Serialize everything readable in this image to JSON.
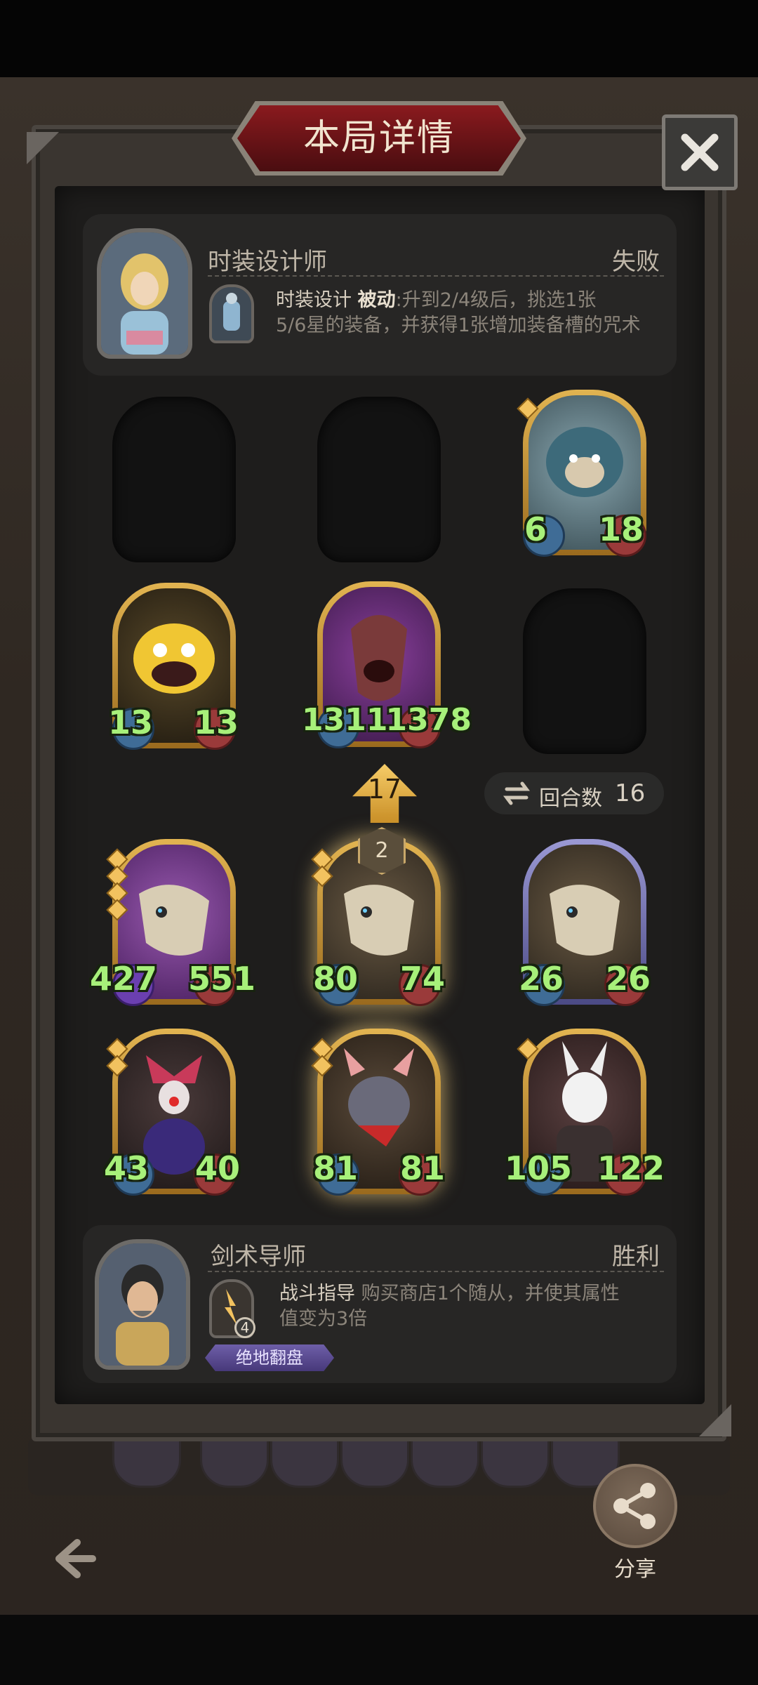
{
  "header": {
    "title": "本局详情"
  },
  "close_icon": "close-icon",
  "player1": {
    "hero_name": "时装设计师",
    "result": "失败",
    "skill_name": "时装设计",
    "skill_type": "被动",
    "skill_desc_line1": ":升到2/4级后，挑选1张",
    "skill_desc_line2": "5/6星的装备，并获得1张增加装备槽的咒术"
  },
  "board": {
    "row1": [
      {
        "slot": "empty"
      },
      {
        "slot": "empty"
      },
      {
        "atk": "6",
        "hp": "18",
        "stars": 1,
        "frame": "gold",
        "art": "blue-beast"
      }
    ],
    "row2": [
      {
        "atk": "13",
        "hp": "13",
        "stars": 0,
        "frame": "gold",
        "art": "yellow-gremlin"
      },
      {
        "atk": "1311",
        "hp": "1378",
        "stars": 0,
        "frame": "gold",
        "art": "purple-dragon"
      },
      {
        "slot": "empty"
      }
    ],
    "row3": [
      {
        "atk": "427",
        "hp": "551",
        "stars": 4,
        "frame": "gold",
        "art": "bone-dragon-purple"
      },
      {
        "atk": "80",
        "hp": "74",
        "stars": 2,
        "frame": "gold",
        "art": "bone-dragon"
      },
      {
        "atk": "26",
        "hp": "26",
        "stars": 0,
        "frame": "silver",
        "art": "bone-dragon"
      }
    ],
    "row4": [
      {
        "atk": "43",
        "hp": "40",
        "stars": 2,
        "frame": "gold",
        "art": "clown"
      },
      {
        "atk": "81",
        "hp": "81",
        "stars": 2,
        "frame": "gold",
        "art": "rat-warrior"
      },
      {
        "atk": "105",
        "hp": "122",
        "stars": 1,
        "frame": "gold",
        "art": "rabbit-mask"
      }
    ],
    "up_arrow_value": "17",
    "level_badge": "2"
  },
  "round": {
    "label": "回合数",
    "value": "16"
  },
  "player2": {
    "hero_name": "剑术导师",
    "result": "胜利",
    "skill_name": "战斗指导",
    "skill_desc_line1": " 购买商店1个随从，并使其属性",
    "skill_desc_line2": "值变为3倍",
    "skill_level": "4",
    "tag": "绝地翻盘"
  },
  "footer": {
    "share_label": "分享"
  },
  "colors": {
    "accent_gold": "#e2b451",
    "stat_green": "#a7f07a",
    "title_red": "#8a1a1e"
  }
}
